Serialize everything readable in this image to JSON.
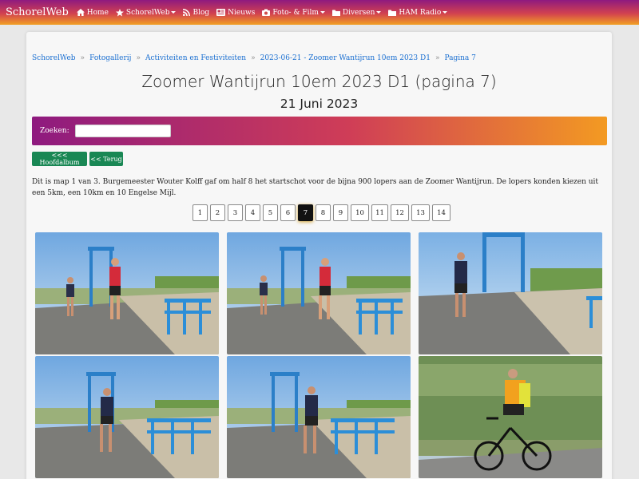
{
  "nav": {
    "brand": "SchorelWeb",
    "items": [
      {
        "label": "Home",
        "icon": "home-icon",
        "dropdown": false
      },
      {
        "label": "SchorelWeb",
        "icon": "star-icon",
        "dropdown": true
      },
      {
        "label": "Blog",
        "icon": "rss-icon",
        "dropdown": false
      },
      {
        "label": "Nieuws",
        "icon": "newspaper-icon",
        "dropdown": false
      },
      {
        "label": "Foto- & Film",
        "icon": "camera-icon",
        "dropdown": true
      },
      {
        "label": "Diversen",
        "icon": "folder-icon",
        "dropdown": true
      },
      {
        "label": "HAM Radio",
        "icon": "folder-icon",
        "dropdown": true
      }
    ]
  },
  "breadcrumb": [
    "SchorelWeb",
    "Fotogallerij",
    "Activiteiten en Festiviteiten",
    "2023-06-21 - Zoomer Wantijrun 10em 2023 D1",
    "Pagina 7"
  ],
  "breadcrumb_sep": "»",
  "title": "Zoomer Wantijrun 10em 2023 D1 (pagina 7)",
  "subtitle": "21 Juni 2023",
  "search": {
    "label": "Zoeken:",
    "value": ""
  },
  "buttons": {
    "album": "<<< Hoofdalbum",
    "back": "<< Terug"
  },
  "description": "Dit is map 1 van 3. Burgemeester Wouter Kolff gaf om half 8 het startschot voor de bijna 900 lopers aan de Zoomer Wantijrun. De lopers konden kiezen uit een 5km, een 10km en 10 Engelse Mijl.",
  "pages": [
    "1",
    "2",
    "3",
    "4",
    "5",
    "6",
    "7",
    "8",
    "9",
    "10",
    "11",
    "12",
    "13",
    "14"
  ],
  "current_page": "7",
  "colors": {
    "accent_green": "#198754",
    "link": "#1a6fd1",
    "gradient_start": "#8e1a7f",
    "gradient_end": "#f39a22"
  }
}
